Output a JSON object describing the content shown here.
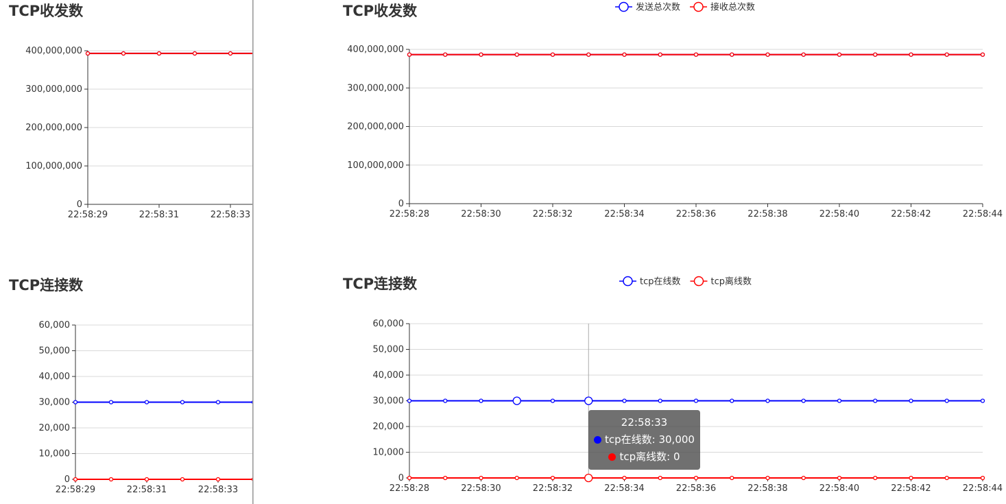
{
  "panels": {
    "left": {
      "charts": [
        {
          "title": "TCP收发数"
        },
        {
          "title": "TCP连接数"
        }
      ]
    },
    "right": {
      "charts": [
        {
          "title": "TCP收发数",
          "legend": [
            "发送总次数",
            "接收总次数"
          ]
        },
        {
          "title": "TCP连接数",
          "legend": [
            "tcp在线数",
            "tcp离线数"
          ]
        }
      ],
      "tooltip": {
        "time": "22:58:33",
        "rows": [
          {
            "label": "tcp在线数: 30,000",
            "color": "#0000ff"
          },
          {
            "label": "tcp离线数: 0",
            "color": "#ff0000"
          }
        ]
      }
    }
  },
  "chart_data": [
    {
      "type": "line",
      "title": "TCP收发数",
      "x": [
        "22:58:29",
        "22:58:30",
        "22:58:31",
        "22:58:32",
        "22:58:33",
        "22:58:34"
      ],
      "xticks": [
        "22:58:29",
        "22:58:31",
        "22:58:33"
      ],
      "series": [
        {
          "name": "发送总次数",
          "color": "#0000ff",
          "values": [
            393000000,
            393000000,
            393000000,
            393000000,
            393000000,
            393000000
          ]
        },
        {
          "name": "接收总次数",
          "color": "#ff0000",
          "values": [
            393000000,
            393000000,
            393000000,
            393000000,
            393000000,
            393000000
          ]
        }
      ],
      "ylim": [
        0,
        400000000
      ],
      "yticks": [
        0,
        100000000,
        200000000,
        300000000,
        400000000
      ],
      "grid": true
    },
    {
      "type": "line",
      "title": "TCP连接数",
      "x": [
        "22:58:29",
        "22:58:30",
        "22:58:31",
        "22:58:32",
        "22:58:33",
        "22:58:34"
      ],
      "xticks": [
        "22:58:29",
        "22:58:31",
        "22:58:33"
      ],
      "series": [
        {
          "name": "tcp在线数",
          "color": "#0000ff",
          "values": [
            30000,
            30000,
            30000,
            30000,
            30000,
            30000
          ]
        },
        {
          "name": "tcp离线数",
          "color": "#ff0000",
          "values": [
            0,
            0,
            0,
            0,
            0,
            0
          ]
        }
      ],
      "ylim": [
        0,
        60000
      ],
      "yticks": [
        0,
        10000,
        20000,
        30000,
        40000,
        50000,
        60000
      ],
      "grid": true
    },
    {
      "type": "line",
      "title": "TCP收发数",
      "x": [
        "22:58:28",
        "22:58:29",
        "22:58:30",
        "22:58:31",
        "22:58:32",
        "22:58:33",
        "22:58:34",
        "22:58:35",
        "22:58:36",
        "22:58:37",
        "22:58:38",
        "22:58:39",
        "22:58:40",
        "22:58:41",
        "22:58:42",
        "22:58:43",
        "22:58:44"
      ],
      "xticks": [
        "22:58:28",
        "22:58:30",
        "22:58:32",
        "22:58:34",
        "22:58:36",
        "22:58:38",
        "22:58:40",
        "22:58:42",
        "22:58:44"
      ],
      "series": [
        {
          "name": "发送总次数",
          "color": "#0000ff",
          "values": [
            386500000,
            386500000,
            386500000,
            386500000,
            386500000,
            386500000,
            386500000,
            386500000,
            386500000,
            386500000,
            386500000,
            386500000,
            386500000,
            386500000,
            386500000,
            386500000,
            386500000
          ]
        },
        {
          "name": "接收总次数",
          "color": "#ff0000",
          "values": [
            386500000,
            386500000,
            386500000,
            386500000,
            386500000,
            386500000,
            386500000,
            386500000,
            386500000,
            386500000,
            386500000,
            386500000,
            386500000,
            386500000,
            386500000,
            386500000,
            386500000
          ]
        }
      ],
      "ylim": [
        0,
        400000000
      ],
      "yticks": [
        0,
        100000000,
        200000000,
        300000000,
        400000000
      ],
      "grid": true,
      "legend": "top-center"
    },
    {
      "type": "line",
      "title": "TCP连接数",
      "x": [
        "22:58:28",
        "22:58:29",
        "22:58:30",
        "22:58:31",
        "22:58:32",
        "22:58:33",
        "22:58:34",
        "22:58:35",
        "22:58:36",
        "22:58:37",
        "22:58:38",
        "22:58:39",
        "22:58:40",
        "22:58:41",
        "22:58:42",
        "22:58:43",
        "22:58:44"
      ],
      "xticks": [
        "22:58:28",
        "22:58:30",
        "22:58:32",
        "22:58:34",
        "22:58:36",
        "22:58:38",
        "22:58:40",
        "22:58:42",
        "22:58:44"
      ],
      "series": [
        {
          "name": "tcp在线数",
          "color": "#0000ff",
          "values": [
            30000,
            30000,
            30000,
            30000,
            30000,
            30000,
            30000,
            30000,
            30000,
            30000,
            30000,
            30000,
            30000,
            30000,
            30000,
            30000,
            30000
          ]
        },
        {
          "name": "tcp离线数",
          "color": "#ff0000",
          "values": [
            0,
            0,
            0,
            0,
            0,
            0,
            0,
            0,
            0,
            0,
            0,
            0,
            0,
            0,
            0,
            0,
            0
          ]
        }
      ],
      "ylim": [
        0,
        60000
      ],
      "yticks": [
        0,
        10000,
        20000,
        30000,
        40000,
        50000,
        60000
      ],
      "grid": true,
      "legend": "top-center",
      "hover": "22:58:33"
    }
  ]
}
